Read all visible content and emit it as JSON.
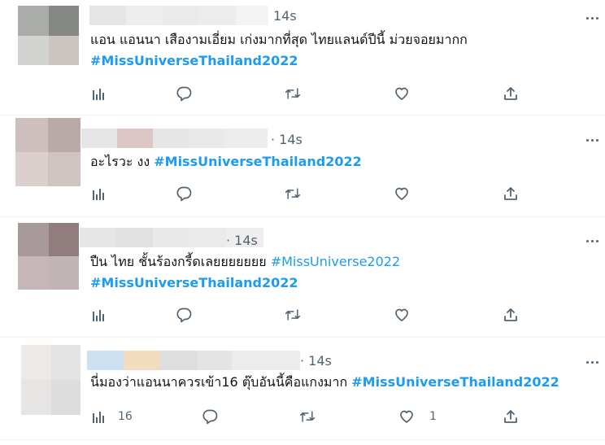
{
  "tweets": [
    {
      "avatar_colors": [
        "#a9aca8",
        "#858884",
        "#d3d3d1",
        "#cbc5c2"
      ],
      "handle_colors": [
        "#e5e5e5",
        "#eeeeee",
        "#eaeaea",
        "#ececec",
        "#f3f3f3"
      ],
      "time": "14s",
      "text_prefix": "แอน แอนนา เสืองามเอี่ยม เก่งมากที่สุด ไทยแลนด์ปีนี้ ม่วยจอยมากก",
      "hashtag": "#MissUniverseThailand2022",
      "counts": {
        "replies": "",
        "likes": ""
      }
    },
    {
      "avatar_colors": [
        "#cdbfbd",
        "#b9a9a7",
        "#dbd0ce",
        "#cfc4c2"
      ],
      "handle_colors": [
        "#e5e5e5",
        "#dcc6c6",
        "#e6e6e6",
        "#e9e9e9",
        "#ececec"
      ],
      "time": "· 14s",
      "text_prefix": "อะไรวะ งง",
      "hashtag": "#MissUniverseThailand2022",
      "counts": {
        "replies": "",
        "likes": ""
      }
    },
    {
      "avatar_colors": [
        "#a8999a",
        "#917d7d",
        "#c5b6b8",
        "#c0b4b7"
      ],
      "handle_colors": [
        "#e6e6e6",
        "#e2e2e2",
        "#e9e9e9",
        "#eaeaea",
        "#eeeeee"
      ],
      "time": "· 14s",
      "text_prefix": "ปืน ไทย ชั้นร้องกรี้ดเลยยยยยยย",
      "hashtag_light": "#MissUniverse2022",
      "hashtag": "#MissUniverseThailand2022",
      "counts": {
        "replies": "",
        "likes": ""
      }
    },
    {
      "avatar_colors": [
        "#ece9e7",
        "#e3e3e3",
        "#e7e4e4",
        "#dedddd"
      ],
      "handle_colors": [
        "#cde0f1",
        "#f3dcbd",
        "#dedede",
        "#e4e4e4",
        "#ececec"
      ],
      "time": "· 14s",
      "text_prefix": "นี่มองว่าแอนนาควรเข้า16 ตุ๊บอันนี้คือแกงมาก",
      "hashtag": "#MissUniverseThailand2022",
      "counts": {
        "replies": "16",
        "likes": "1"
      }
    }
  ],
  "icons": [
    "analytics-icon",
    "reply-icon",
    "retweet-icon",
    "like-icon",
    "share-icon",
    "more-icon"
  ],
  "colors": {
    "hashtag": "#1d9bf0",
    "meta": "#536471",
    "text": "#0f1419",
    "divider": "#eff3f4"
  }
}
